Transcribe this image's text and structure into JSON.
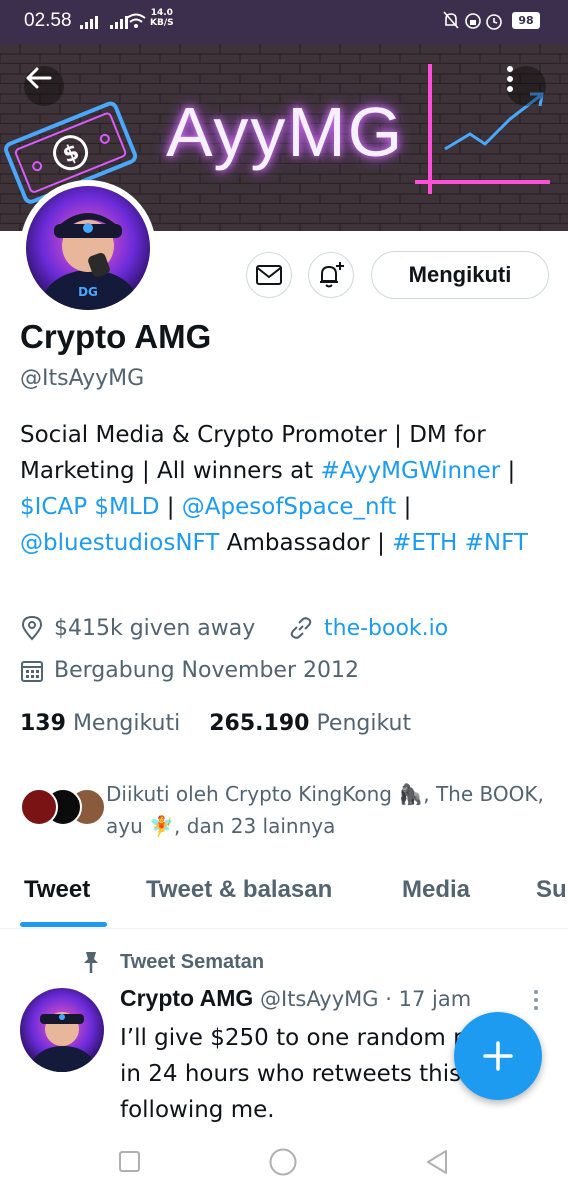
{
  "status_bar": {
    "time": "02.58",
    "speed_value": "14.0",
    "speed_unit": "KB/S",
    "battery": "98"
  },
  "banner": {
    "logo_text": "AyyMG"
  },
  "profile": {
    "name": "Crypto AMG",
    "handle": "@ItsAyyMG",
    "follow_label": "Mengikuti",
    "bio": {
      "t1": "Social Media & Crypto Promoter | DM for Marketing  | All winners at ",
      "l1": "#AyyMGWinner",
      "t2": " | ",
      "l2": "$ICAP",
      "t3": " ",
      "l3": "$MLD",
      "t4": " | ",
      "l4": "@ApesofSpace_nft",
      "t5": " | ",
      "l5": "@bluestudiosNFT",
      "t6": " Ambassador | ",
      "l6": "#ETH",
      "t7": " ",
      "l7": "#NFT"
    },
    "location": "$415k given away",
    "website": "the-book.io",
    "joined": "Bergabung November 2012",
    "following_count": "139",
    "following_label": "Mengikuti",
    "followers_count": "265.190",
    "followers_label": "Pengikut",
    "followed_by": "Diikuti oleh Crypto KingKong 🦍, The BOOK, ayu 🧚, dan 23 lainnya"
  },
  "tabs": [
    "Tweet",
    "Tweet & balasan",
    "Media",
    "Suka"
  ],
  "tweet": {
    "pinned_label": "Tweet Sematan",
    "author": "Crypto AMG",
    "handle": "@ItsAyyMG",
    "dot": "·",
    "time": "17 jam",
    "text": "I’ll give $250 to one random person in 24 hours who retweets this & is following me."
  },
  "colors": {
    "accent": "#1d9bf0",
    "muted": "#536471",
    "text": "#0f1419",
    "statusbar": "#3b2f4d"
  },
  "icons": {
    "back": "arrow-left-icon",
    "more": "more-vertical-icon",
    "message": "mail-icon",
    "notify": "bell-plus-icon",
    "location": "location-pin-icon",
    "link": "link-icon",
    "calendar": "calendar-icon",
    "pin": "pin-icon",
    "compose": "plus-icon"
  }
}
